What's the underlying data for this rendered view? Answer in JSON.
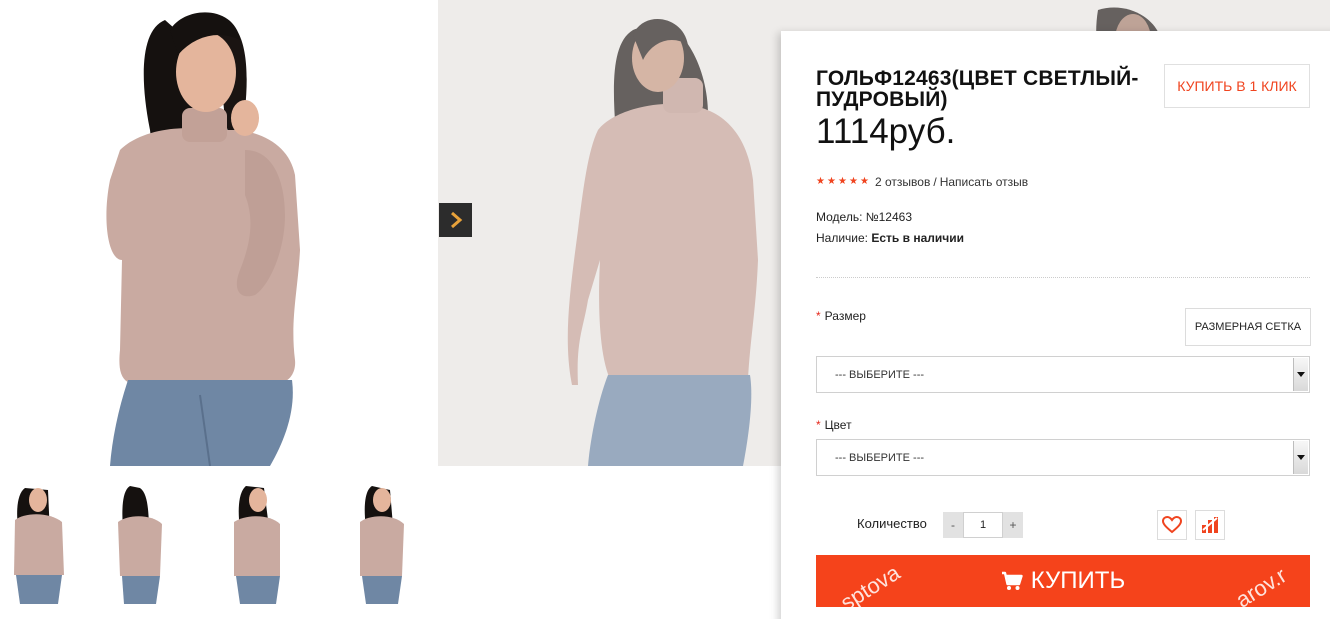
{
  "product": {
    "title": "ГОЛЬФ12463(ЦВЕТ СВЕТЛЫЙ-ПУДРОВЫЙ)",
    "price": "1114руб.",
    "rating": 5,
    "reviews_link": "2 отзывов",
    "review_separator": "/",
    "write_review_link": "Написать отзыв",
    "model_label": "Модель:",
    "model_value": "№12463",
    "stock_label": "Наличие:",
    "stock_value": "Есть в наличии"
  },
  "actions": {
    "buy_one_click": "КУПИТЬ В 1 КЛИК",
    "size_chart": "РАЗМЕРНАЯ СЕТКА",
    "buy": "КУПИТЬ"
  },
  "options": {
    "required_mark": "*",
    "size_label": "Размер",
    "size_selected": "--- ВЫБЕРИТЕ ---",
    "color_label": "Цвет",
    "color_selected": "--- ВЫБЕРИТЕ ---"
  },
  "quantity": {
    "label": "Количество",
    "value": "1",
    "minus": "-",
    "plus": "+"
  },
  "watermark": {
    "left": "sptova",
    "right": "arov.r"
  },
  "icons": {
    "gallery_next": "chevron-right-icon",
    "wishlist": "heart-icon",
    "compare": "compare-icon",
    "cart": "cart-icon",
    "star": "star-icon"
  },
  "colors": {
    "accent": "#f5431b",
    "star": "#f0441f",
    "required": "#e5271b",
    "sweater": "#c9aaa1",
    "jeans": "#6f87a4"
  }
}
